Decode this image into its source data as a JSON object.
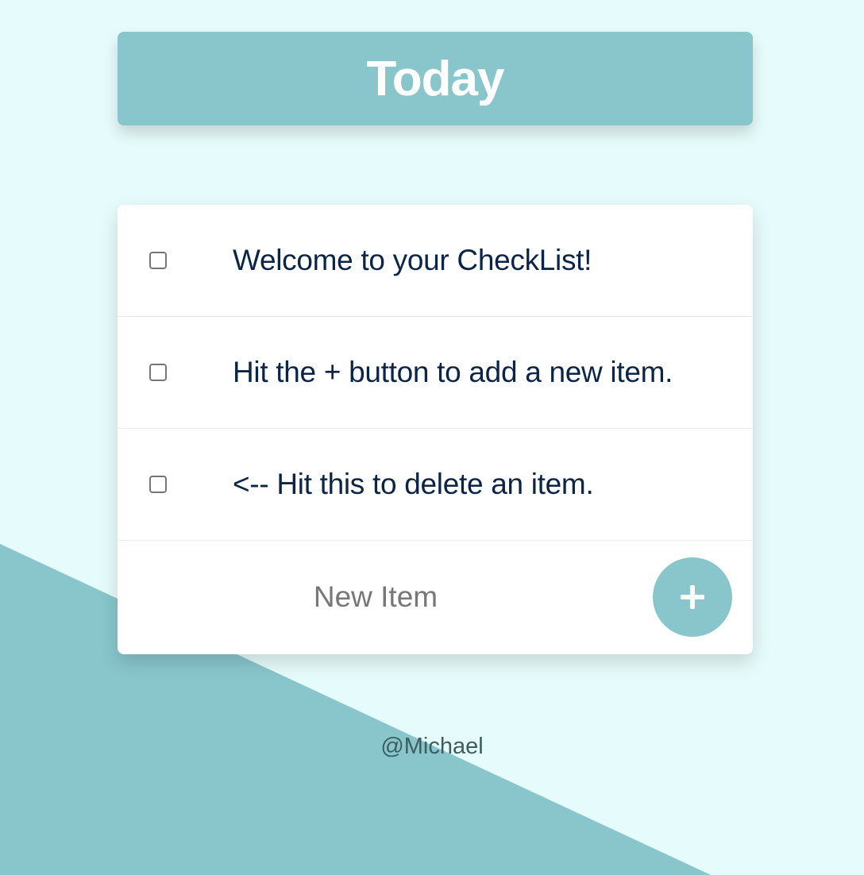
{
  "header": {
    "title": "Today"
  },
  "checklist": {
    "items": [
      {
        "text": "Welcome to your CheckList!",
        "checked": false
      },
      {
        "text": "Hit the + button to add a new item.",
        "checked": false
      },
      {
        "text": "<-- Hit this to delete an item.",
        "checked": false
      }
    ],
    "new_item": {
      "placeholder": "New Item",
      "value": ""
    },
    "add_button_icon": "plus-icon"
  },
  "footer": {
    "text": "@Michael"
  },
  "colors": {
    "background": "#e6fbfb",
    "accent": "#88c6cc",
    "card": "#ffffff",
    "item_text": "#0c2447",
    "placeholder": "#777777"
  }
}
